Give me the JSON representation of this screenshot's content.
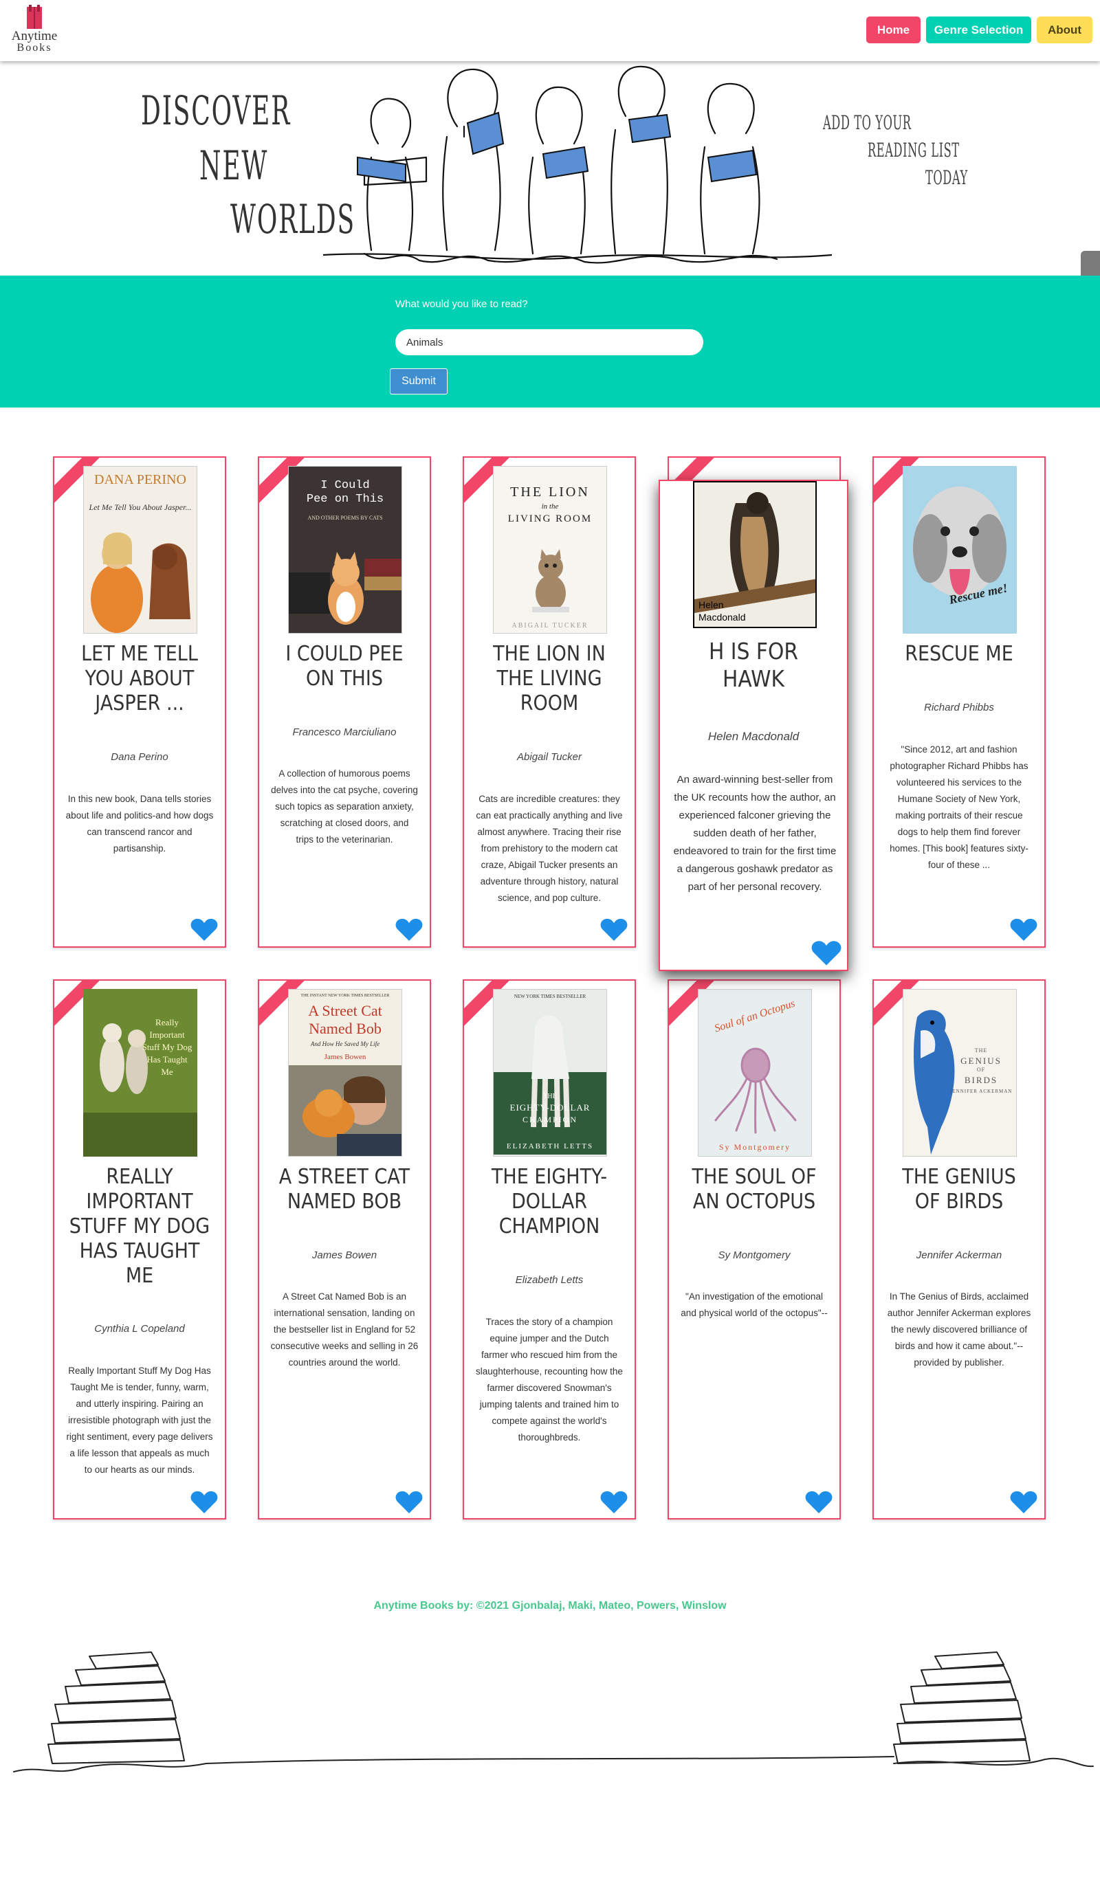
{
  "nav": {
    "logo_line1": "Anytime",
    "logo_line2": "Books",
    "home": "Home",
    "genre": "Genre Selection",
    "about": "About",
    "colors": {
      "home": "#f14668",
      "genre": "#00d1b2",
      "about": "#ffdd57"
    }
  },
  "hero": {
    "left_words": [
      "Discover",
      "new",
      "worlds"
    ],
    "right_words": [
      "Add to your",
      "reading list",
      "today"
    ]
  },
  "search": {
    "label": "What would you like to read?",
    "value": "Animals",
    "submit": "Submit"
  },
  "books": [
    {
      "title": "Let Me Tell You About Jasper ...",
      "author": "Dana Perino",
      "description": "In this new book, Dana tells stories about life and politics-and how dogs can transcend rancor and partisanship.",
      "cover_icon": "dog-photo-cover"
    },
    {
      "title": "I Could Pee on This",
      "author": "Francesco Marciuliano",
      "description": "A collection of humorous poems delves into the cat psyche, covering such topics as separation anxiety, scratching at closed doors, and trips to the veterinarian.",
      "cover_icon": "cat-typewriter-cover"
    },
    {
      "title": "The Lion in the Living Room",
      "author": "Abigail Tucker",
      "description": "Cats are incredible creatures: they can eat practically anything and live almost anywhere. Tracing their rise from prehistory to the modern cat craze, Abigail Tucker presents an adventure through history, natural science, and pop culture.",
      "cover_icon": "kitten-cover"
    },
    {
      "title": "H Is for Hawk",
      "author": "Helen Macdonald",
      "description": "An award-winning best-seller from the UK recounts how the author, an experienced falconer grieving the sudden death of her father, endeavored to train for the first time a dangerous goshawk predator as part of her personal recovery.",
      "cover_icon": "hawk-cover"
    },
    {
      "title": "Rescue Me",
      "author": "Richard Phibbs",
      "description": "\"Since 2012, art and fashion photographer Richard Phibbs has volunteered his services to the Humane Society of New York, making portraits of their rescue dogs to help them find forever homes. [This book] features sixty-four of these ...",
      "cover_icon": "dog-portrait-cover"
    },
    {
      "title": "Really Important Stuff My Dog Has Taught Me",
      "author": "Cynthia L Copeland",
      "description": "Really Important Stuff My Dog Has Taught Me is tender, funny, warm, and utterly inspiring. Pairing an irresistible photograph with just the right sentiment, every page delivers a life lesson that appeals as much to our hearts as our minds.",
      "cover_icon": "dogs-running-cover"
    },
    {
      "title": "A Street Cat Named Bob",
      "author": "James Bowen",
      "description": "A Street Cat Named Bob is an international sensation, landing on the bestseller list in England for 52 consecutive weeks and selling in 26 countries around the world.",
      "cover_icon": "man-with-cat-cover"
    },
    {
      "title": "The Eighty-Dollar Champion",
      "author": "Elizabeth Letts",
      "description": "Traces the story of a champion equine jumper and the Dutch farmer who rescued him from the slaughterhouse, recounting how the farmer discovered Snowman's jumping talents and trained him to compete against the world's thoroughbreds.",
      "cover_icon": "horse-cover"
    },
    {
      "title": "The Soul of an Octopus",
      "author": "Sy Montgomery",
      "description": "\"An investigation of the emotional and physical world of the octopus\"--",
      "cover_icon": "octopus-cover"
    },
    {
      "title": "The Genius of Birds",
      "author": "Jennifer Ackerman",
      "description": "In The Genius of Birds, acclaimed author Jennifer Ackerman explores the newly discovered brilliance of birds and how it came about.\"--provided by publisher.",
      "cover_icon": "blue-jay-cover"
    }
  ],
  "covers": {
    "jasper_top": "DANA PERINO",
    "jasper_sub": "Let Me Tell You About Jasper...",
    "pee_line1": "I Could",
    "pee_line2": "Pee on This",
    "pee_line3": "AND OTHER POEMS BY CATS",
    "lion_line1": "THE LION",
    "lion_line2": "in the",
    "lion_line3": "LIVING ROOM",
    "lion_author": "ABIGAIL TUCKER",
    "hawk_author1": "Helen",
    "hawk_author2": "Macdonald",
    "rescue_text": "Rescue me!",
    "really_text": "Really Important Stuff My Dog Has Taught Me",
    "bob_banner": "THE INSTANT NEW YORK TIMES BESTSELLER",
    "bob_line1": "A Street Cat",
    "bob_line2": "Named Bob",
    "bob_sub": "And How He Saved My Life",
    "bob_author": "James Bowen",
    "horse_banner": "NEW YORK TIMES BESTSELLER",
    "horse_line1": "THE",
    "horse_line2": "EIGHTY-DOLLAR",
    "horse_line3": "CHAMPION",
    "horse_author": "ELIZABETH LETTS",
    "octo_line1": "Soul of an Octopus",
    "octo_author": "Sy Montgomery",
    "birds_line1": "THE",
    "birds_line2": "GENIUS",
    "birds_line3": "OF",
    "birds_line4": "BIRDS",
    "birds_author": "JENNIFER ACKERMAN"
  },
  "footer": {
    "credit": "Anytime Books by: ©2021 Gjonbalaj, Maki, Mateo, Powers, Winslow"
  },
  "accent_colors": {
    "card_border": "#f14668",
    "heart": "#1e8fe8",
    "search_bg": "#00d1b2",
    "footer_text": "#48c78e"
  }
}
